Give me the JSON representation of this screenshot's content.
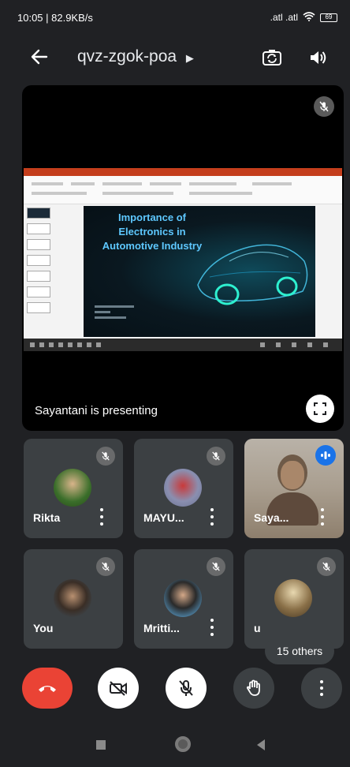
{
  "status_bar": {
    "time_speed": "10:05 | 82.9KB/s",
    "signal": ".atl .atl",
    "battery": "69"
  },
  "header": {
    "meeting_code": "qvz-zgok-poa"
  },
  "presentation": {
    "slide_title_1": "Importance of",
    "slide_title_2": "Electronics in",
    "slide_title_3": "Automotive Industry",
    "presenting_label": "Sayantani is presenting"
  },
  "participants": [
    {
      "name": "Rikta"
    },
    {
      "name": "MAYU..."
    },
    {
      "name": "Saya..."
    },
    {
      "name": "You"
    },
    {
      "name": "Mritti..."
    },
    {
      "name": "u"
    }
  ],
  "others_label": "15 others",
  "colors": {
    "background": "#202124",
    "tile": "#3c4043",
    "end_call": "#ea4335",
    "speaking": "#1a73e8"
  },
  "icons": {
    "back": "arrow-left-icon",
    "switch_camera": "switch-camera-icon",
    "speaker": "speaker-icon",
    "mic_off": "mic-off-icon",
    "fullscreen": "fullscreen-icon",
    "end_call": "phone-hangup-icon",
    "camera_off": "camera-off-icon",
    "raise_hand": "raise-hand-icon",
    "more": "more-vert-icon"
  }
}
